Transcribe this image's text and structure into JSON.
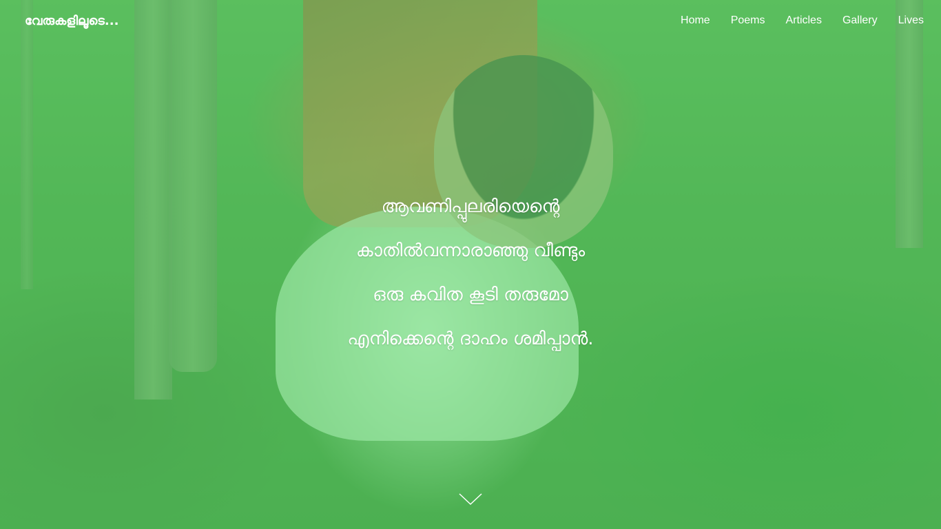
{
  "brand": "വേരുകളിലൂടെ...",
  "nav": {
    "items": [
      "Home",
      "Poems",
      "Articles",
      "Gallery",
      "Lives"
    ]
  },
  "poem": {
    "lines": [
      "ആവണിപ്പുലരിയെന്റെ",
      "കാതിൽവന്നാരാഞ്ഞു വീണ്ടും",
      "ഒരു കവിത കൂടി തരുമോ",
      "എനിക്കെന്റെ ദാഹം ശമിപ്പാൻ."
    ]
  },
  "colors": {
    "overlay": "#58dc6e",
    "text": "#ffffff"
  },
  "icons": {
    "scroll": "chevron-down-icon"
  }
}
